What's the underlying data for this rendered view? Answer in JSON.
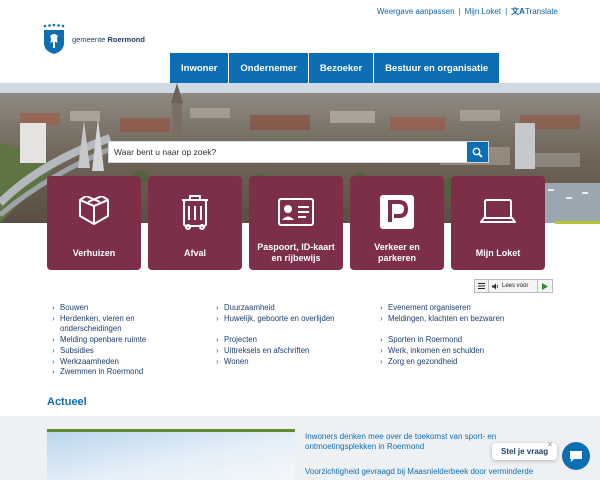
{
  "utility": {
    "adjust_label": "Weergave aanpassen",
    "myloket_label": "Mijn Loket",
    "translate_label": "Translate",
    "translate_icon": "translate-icon"
  },
  "logo": {
    "prefix": "gemeente",
    "name": "Roermond"
  },
  "nav": {
    "items": [
      "Inwoner",
      "Ondernemer",
      "Bezoeker",
      "Bestuur en organisatie"
    ]
  },
  "search": {
    "placeholder": "Waar bent u naar op zoek?",
    "icon": "search-icon"
  },
  "tiles": [
    {
      "label": "Verhuizen",
      "icon": "box-icon"
    },
    {
      "label": "Afval",
      "icon": "bin-icon"
    },
    {
      "label": "Paspoort, ID-kaart en rijbewijs",
      "icon": "id-card-icon"
    },
    {
      "label": "Verkeer en parkeren",
      "icon": "parking-icon"
    },
    {
      "label": "Mijn Loket",
      "icon": "laptop-icon"
    }
  ],
  "readspeaker": {
    "label": "Lees voor"
  },
  "links": {
    "col1": [
      "Bouwen",
      "Herdenken, vieren en onderscheidingen",
      "Melding openbare ruimte",
      "Subsidies",
      "Werkzaamheden",
      "Zwemmen in Roermond"
    ],
    "col2": [
      "Duurzaamheid",
      "Huwelijk, geboorte en overlijden",
      "Projecten",
      "Uittreksels en afschriften",
      "Wonen"
    ],
    "col3": [
      "Evenement organiseren",
      "Meldingen, klachten en bezwaren",
      "Sporten in Roermond",
      "Werk, inkomen en schulden",
      "Zorg en gezondheid"
    ]
  },
  "actueel": {
    "title": "Actueel",
    "news": [
      "Inwoners denken mee over de toekomst van sport- en ontmoetingsplekken in Roermond",
      "Voorzichtigheid gevraagd bij Maasnielderbeek door verminderde"
    ]
  },
  "chat": {
    "label": "Stel je vraag"
  },
  "colors": {
    "primary": "#0d6eb3",
    "tile": "#7d2f48",
    "accent_green": "#b5c729",
    "text": "#1c3f6e"
  }
}
